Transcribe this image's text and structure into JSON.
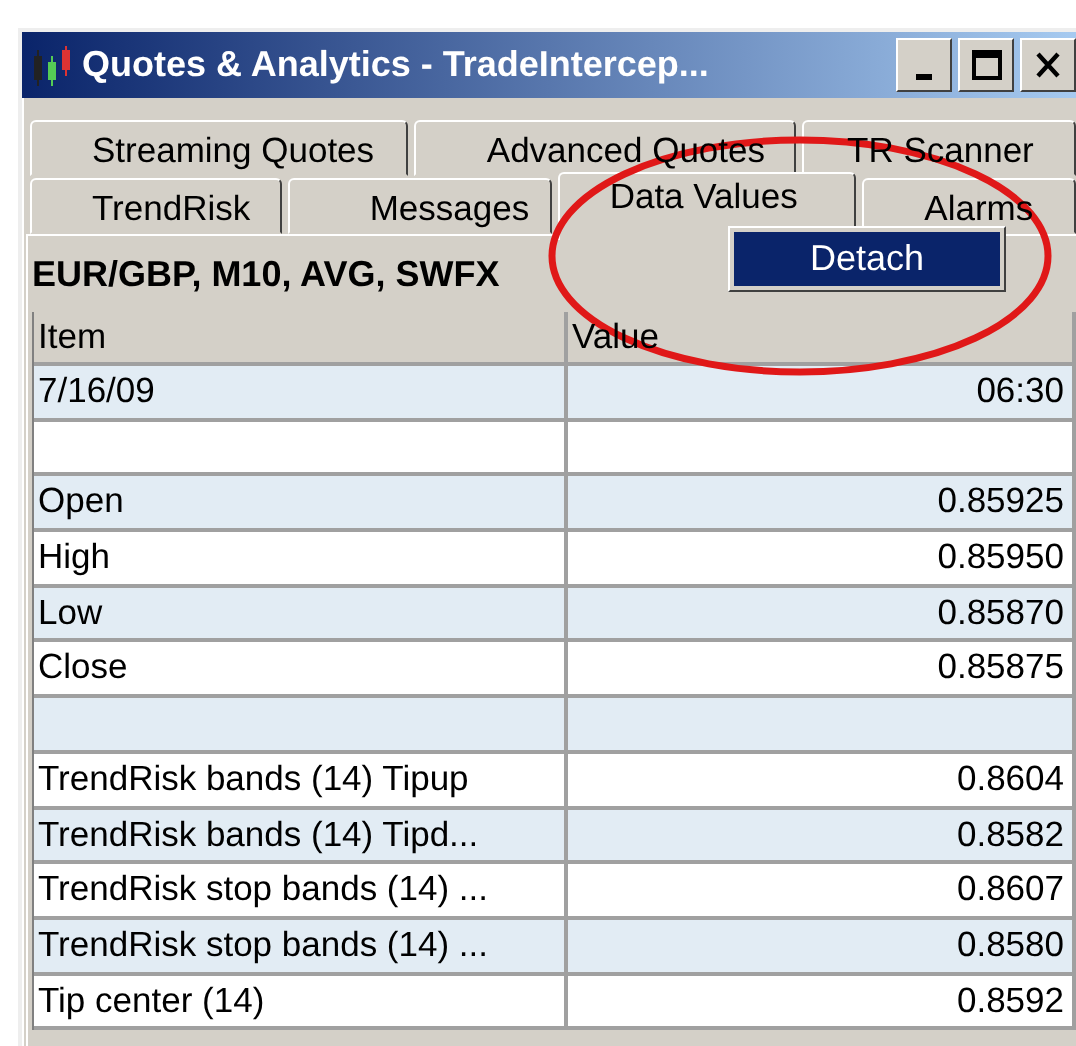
{
  "window": {
    "title": "Quotes & Analytics - TradeIntercep..."
  },
  "tab_rows": [
    [
      {
        "label": "Streaming Quotes",
        "selected": false
      },
      {
        "label": "Advanced Quotes",
        "selected": false
      },
      {
        "label": "TR Scanner",
        "selected": false
      }
    ],
    [
      {
        "label": "TrendRisk",
        "selected": false
      },
      {
        "label": "Messages",
        "selected": false
      },
      {
        "label": "Data Values",
        "selected": true
      },
      {
        "label": "Alarms",
        "selected": false
      }
    ]
  ],
  "context_menu": {
    "items": [
      {
        "label": "Detach",
        "selected": true
      }
    ]
  },
  "symbol_header": "EUR/GBP, M10, AVG, SWFX",
  "table": {
    "columns": [
      "Item",
      "Value"
    ],
    "rows": [
      [
        "7/16/09",
        "06:30"
      ],
      [
        "",
        ""
      ],
      [
        "Open",
        "0.85925"
      ],
      [
        "High",
        "0.85950"
      ],
      [
        "Low",
        "0.85870"
      ],
      [
        "Close",
        "0.85875"
      ],
      [
        "",
        ""
      ],
      [
        "TrendRisk bands (14) Tipup",
        "0.8604"
      ],
      [
        "TrendRisk bands (14) Tipd...",
        "0.8582"
      ],
      [
        "TrendRisk stop bands (14) ...",
        "0.8607"
      ],
      [
        "TrendRisk stop bands (14) ...",
        "0.8580"
      ],
      [
        "Tip center (14)",
        "0.8592"
      ]
    ]
  }
}
